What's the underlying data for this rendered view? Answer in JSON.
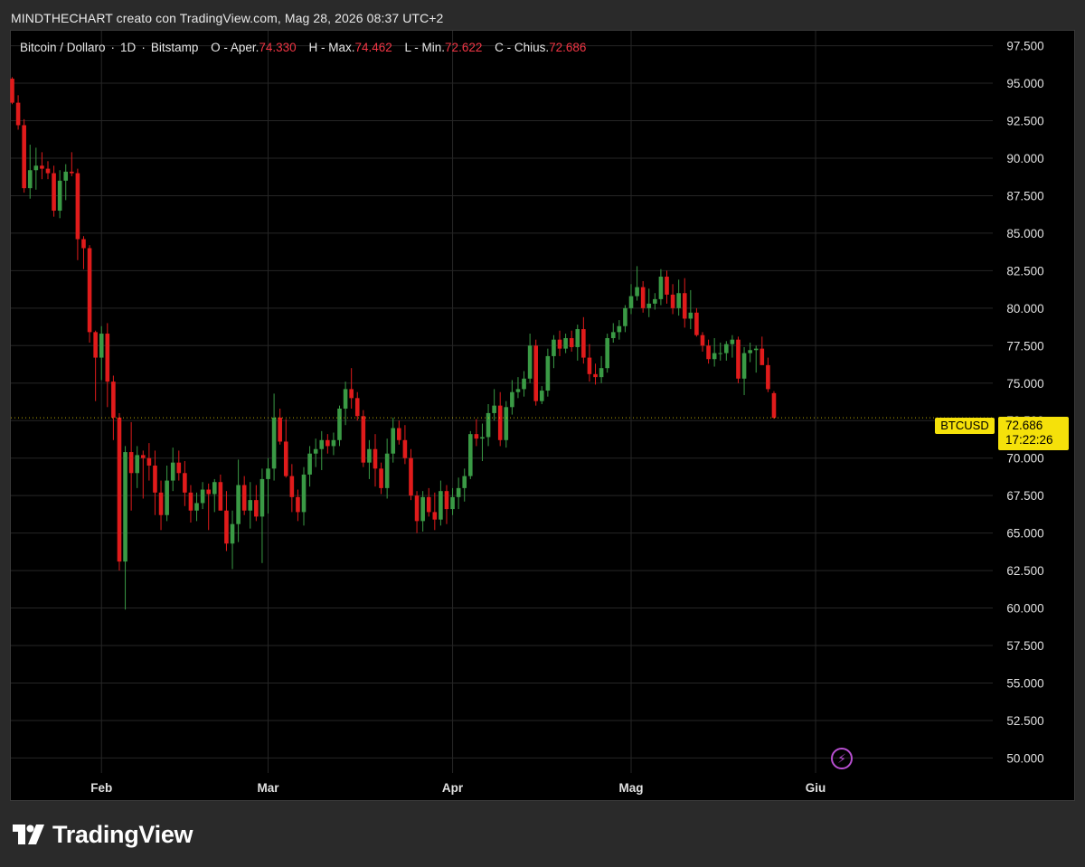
{
  "attribution": "MINDTHECHART creato con TradingView.com, Mag 28, 2026 08:37 UTC+2",
  "legend": {
    "symbol": "Bitcoin / Dollaro",
    "interval": "1D",
    "exchange": "Bitstamp",
    "open_label": "O - Aper.",
    "open_value": "74.330",
    "high_label": "H - Max.",
    "high_value": "74.462",
    "low_label": "L - Min.",
    "low_value": "72.622",
    "close_label": "C - Chius.",
    "close_value": "72.686"
  },
  "price_tag": {
    "symbol": "BTCUSD",
    "price": "72.686",
    "countdown": "17:22:26"
  },
  "logo_text": "TradingView",
  "icons": {
    "logo": "tradingview-logo-icon",
    "alert": "lightning-bolt-icon"
  },
  "colors": {
    "up": "#3a9a45",
    "down": "#e01b1b",
    "background": "#000000",
    "grid": "#262626",
    "price_line": "#f5e10a",
    "axis_text": "#e0e0e0"
  },
  "chart_data": {
    "type": "candlestick",
    "ylim": [
      49000,
      98500
    ],
    "y_ticks": [
      "97.500",
      "95.000",
      "92.500",
      "90.000",
      "87.500",
      "85.000",
      "82.500",
      "80.000",
      "77.500",
      "75.000",
      "72.500",
      "70.000",
      "67.500",
      "65.000",
      "62.500",
      "60.000",
      "57.500",
      "55.000",
      "52.500",
      "50.000"
    ],
    "y_tick_values": [
      97500,
      95000,
      92500,
      90000,
      87500,
      85000,
      82500,
      80000,
      77500,
      75000,
      72500,
      70000,
      67500,
      65000,
      62500,
      60000,
      57500,
      55000,
      52500,
      50000
    ],
    "x_ticks": [
      {
        "label": "Feb",
        "day": 0
      },
      {
        "label": "Mar",
        "day": 28
      },
      {
        "label": "Apr",
        "day": 59
      },
      {
        "label": "Mag",
        "day": 89
      },
      {
        "label": "Giu",
        "day": 120
      }
    ],
    "x_range_days": [
      -15,
      150
    ],
    "last_price": 72686,
    "first_day": -15,
    "ohlc": [
      [
        95300,
        95400,
        93600,
        93700
      ],
      [
        93700,
        94200,
        91900,
        92200
      ],
      [
        92200,
        92600,
        87700,
        88000
      ],
      [
        88000,
        90900,
        87300,
        89200
      ],
      [
        89200,
        90700,
        87900,
        89500
      ],
      [
        89500,
        90400,
        88600,
        89300
      ],
      [
        89300,
        89800,
        88600,
        89000
      ],
      [
        89000,
        89500,
        86100,
        86500
      ],
      [
        86500,
        89200,
        86000,
        88500
      ],
      [
        88500,
        89600,
        87200,
        89100
      ],
      [
        89100,
        90400,
        88800,
        89000
      ],
      [
        89000,
        89300,
        83200,
        84600
      ],
      [
        84600,
        84800,
        82600,
        84000
      ],
      [
        84000,
        84200,
        77700,
        78400
      ],
      [
        78400,
        78500,
        73800,
        76700
      ],
      [
        76700,
        78800,
        75200,
        78300
      ],
      [
        78300,
        79000,
        73400,
        75100
      ],
      [
        75100,
        75500,
        71200,
        72700
      ],
      [
        72700,
        73000,
        62500,
        63100
      ],
      [
        63100,
        70800,
        59900,
        70400
      ],
      [
        70400,
        72400,
        66500,
        69000
      ],
      [
        69000,
        70800,
        68000,
        70200
      ],
      [
        70200,
        70500,
        67300,
        70000
      ],
      [
        70000,
        71000,
        68500,
        69500
      ],
      [
        69500,
        70500,
        66200,
        67700
      ],
      [
        67700,
        68500,
        65200,
        66200
      ],
      [
        66200,
        69500,
        65800,
        68500
      ],
      [
        68500,
        70700,
        67800,
        69700
      ],
      [
        69700,
        70500,
        68500,
        69000
      ],
      [
        69000,
        69800,
        66800,
        67700
      ],
      [
        67700,
        68200,
        65700,
        66500
      ],
      [
        66500,
        67700,
        65800,
        67000
      ],
      [
        67000,
        68400,
        66600,
        67900
      ],
      [
        67900,
        68300,
        65200,
        67600
      ],
      [
        67600,
        68600,
        66400,
        68400
      ],
      [
        68400,
        68900,
        66500,
        66500
      ],
      [
        66500,
        67800,
        63800,
        64300
      ],
      [
        64300,
        66500,
        62600,
        65600
      ],
      [
        65600,
        69900,
        64400,
        68200
      ],
      [
        68200,
        68800,
        66200,
        66500
      ],
      [
        66500,
        68400,
        65300,
        67200
      ],
      [
        67200,
        68200,
        65800,
        66100
      ],
      [
        66100,
        69300,
        63000,
        68600
      ],
      [
        68600,
        70000,
        66300,
        69300
      ],
      [
        69300,
        74300,
        68500,
        72700
      ],
      [
        72700,
        73300,
        70900,
        71100
      ],
      [
        71100,
        72600,
        68700,
        68800
      ],
      [
        68800,
        69600,
        66400,
        67400
      ],
      [
        67400,
        67900,
        65800,
        66400
      ],
      [
        66400,
        69400,
        65500,
        68900
      ],
      [
        68900,
        70800,
        68100,
        70300
      ],
      [
        70300,
        71300,
        69400,
        70600
      ],
      [
        70600,
        71800,
        69200,
        71200
      ],
      [
        71200,
        71600,
        70300,
        70800
      ],
      [
        70800,
        71700,
        70200,
        71200
      ],
      [
        71200,
        73500,
        70800,
        73300
      ],
      [
        73300,
        75100,
        72200,
        74600
      ],
      [
        74600,
        76000,
        73300,
        74000
      ],
      [
        74000,
        74400,
        72500,
        72800
      ],
      [
        72800,
        73200,
        69400,
        69700
      ],
      [
        69700,
        71200,
        68600,
        70600
      ],
      [
        70600,
        71600,
        68100,
        69300
      ],
      [
        69300,
        69700,
        67600,
        68000
      ],
      [
        68000,
        71300,
        67300,
        70300
      ],
      [
        70300,
        72700,
        69700,
        72000
      ],
      [
        72000,
        72500,
        70900,
        71200
      ],
      [
        71200,
        72200,
        69600,
        70000
      ],
      [
        70000,
        70600,
        67200,
        67500
      ],
      [
        67500,
        67800,
        65000,
        65800
      ],
      [
        65800,
        67800,
        65100,
        67400
      ],
      [
        67400,
        68000,
        66100,
        66400
      ],
      [
        66400,
        67700,
        65200,
        65900
      ],
      [
        65900,
        68500,
        65500,
        67800
      ],
      [
        67800,
        68200,
        65600,
        66600
      ],
      [
        66600,
        68000,
        66200,
        67400
      ],
      [
        67400,
        68700,
        66600,
        68000
      ],
      [
        68000,
        69300,
        67100,
        68800
      ],
      [
        68800,
        71800,
        68600,
        71600
      ],
      [
        71600,
        72600,
        70800,
        71300
      ],
      [
        71300,
        72300,
        69800,
        71400
      ],
      [
        71400,
        73600,
        70800,
        73000
      ],
      [
        73000,
        74600,
        72500,
        73500
      ],
      [
        73500,
        74400,
        70800,
        71200
      ],
      [
        71200,
        73800,
        70700,
        73400
      ],
      [
        73400,
        75200,
        72900,
        74400
      ],
      [
        74400,
        75400,
        74000,
        74600
      ],
      [
        74600,
        75800,
        74100,
        75300
      ],
      [
        75300,
        78300,
        75000,
        77500
      ],
      [
        77500,
        77900,
        73500,
        73800
      ],
      [
        73800,
        74800,
        73600,
        74500
      ],
      [
        74500,
        77300,
        74100,
        76800
      ],
      [
        76800,
        78200,
        76000,
        77900
      ],
      [
        77900,
        78500,
        76800,
        77300
      ],
      [
        77300,
        78300,
        77000,
        78000
      ],
      [
        78000,
        78500,
        77100,
        77400
      ],
      [
        77400,
        78900,
        76500,
        78600
      ],
      [
        78600,
        79400,
        76300,
        76700
      ],
      [
        76700,
        77600,
        75100,
        75600
      ],
      [
        75600,
        76300,
        74900,
        75400
      ],
      [
        75400,
        76800,
        75000,
        76000
      ],
      [
        76000,
        78300,
        75700,
        78000
      ],
      [
        78000,
        79000,
        77700,
        78400
      ],
      [
        78400,
        79200,
        77900,
        78800
      ],
      [
        78800,
        80200,
        78400,
        80000
      ],
      [
        80000,
        81600,
        79600,
        80800
      ],
      [
        80800,
        82800,
        80500,
        81400
      ],
      [
        81400,
        81800,
        79700,
        80000
      ],
      [
        80000,
        81300,
        79400,
        80300
      ],
      [
        80300,
        81000,
        79900,
        80600
      ],
      [
        80600,
        82600,
        80200,
        82100
      ],
      [
        82100,
        82500,
        80300,
        80900
      ],
      [
        80900,
        81600,
        79600,
        80000
      ],
      [
        80000,
        81900,
        79500,
        81000
      ],
      [
        81000,
        82000,
        78700,
        79300
      ],
      [
        79300,
        81200,
        78600,
        79700
      ],
      [
        79700,
        80000,
        78100,
        78200
      ],
      [
        78200,
        78400,
        77100,
        77500
      ],
      [
        77500,
        77900,
        76300,
        76600
      ],
      [
        76600,
        78000,
        76100,
        77000
      ],
      [
        77000,
        77700,
        76500,
        77000
      ],
      [
        77000,
        77800,
        76500,
        77600
      ],
      [
        77600,
        78200,
        76700,
        77900
      ],
      [
        77900,
        78100,
        75000,
        75300
      ],
      [
        75300,
        77400,
        74200,
        77000
      ],
      [
        77000,
        77700,
        76400,
        77200
      ],
      [
        77200,
        77500,
        75700,
        77300
      ],
      [
        77300,
        78100,
        76600,
        76200
      ],
      [
        76200,
        76700,
        74400,
        74600
      ],
      [
        74330,
        74462,
        72622,
        72686
      ]
    ]
  }
}
